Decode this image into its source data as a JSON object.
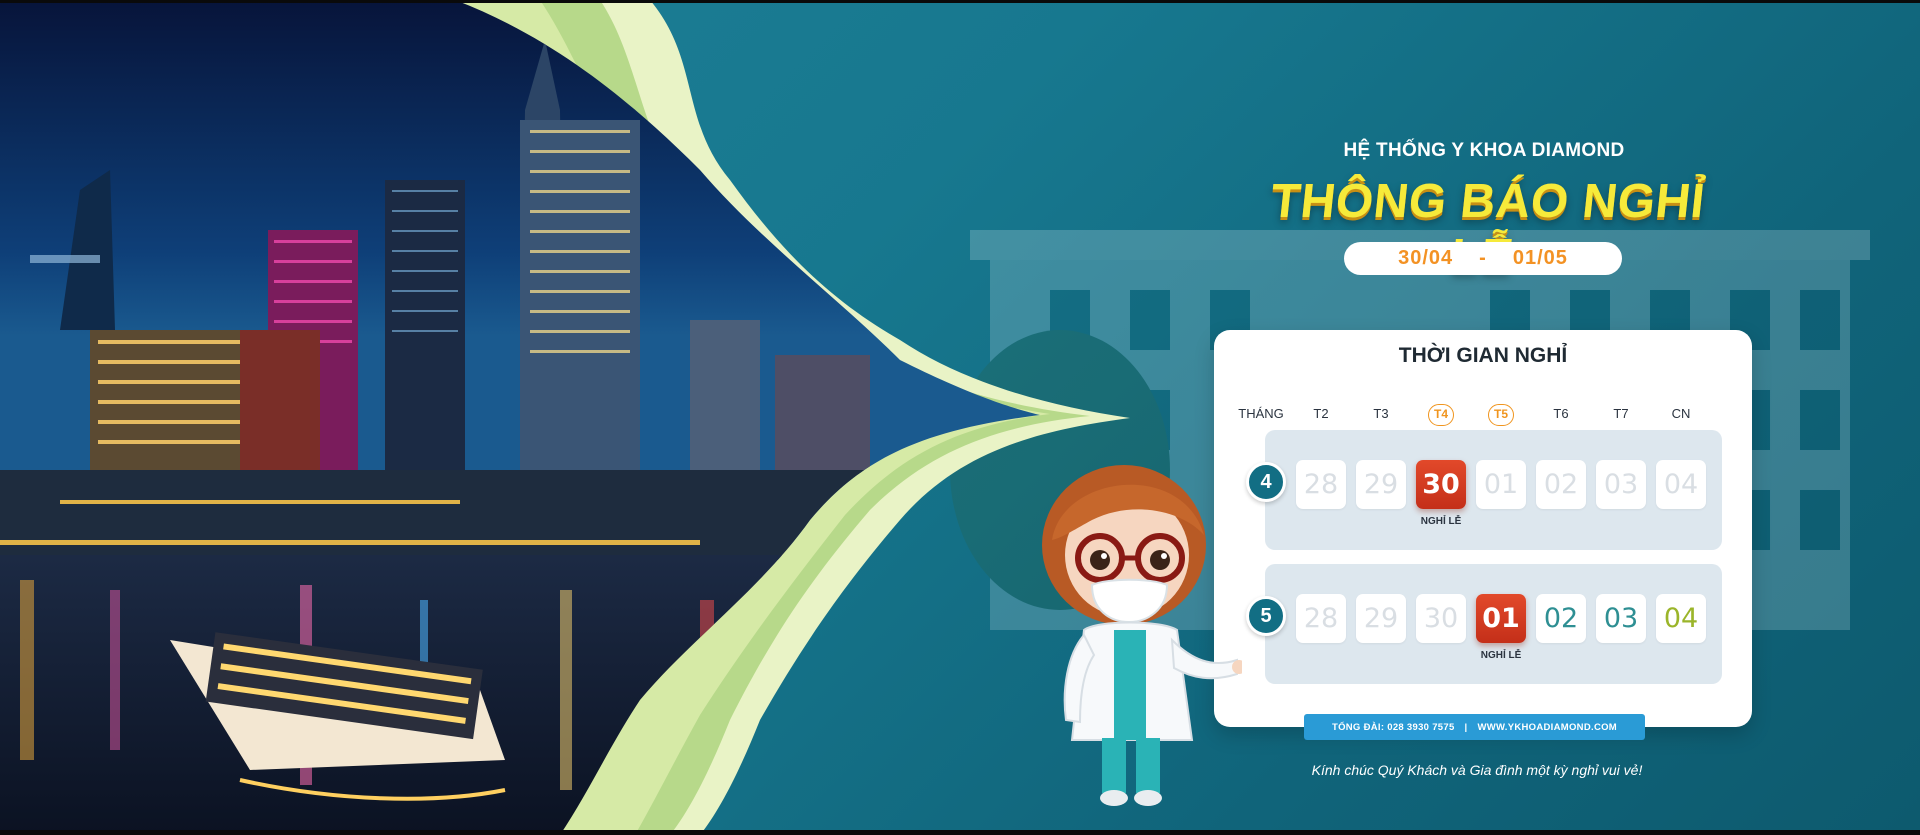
{
  "header": {
    "brand": "HỆ THỐNG Y KHOA DIAMOND",
    "title": "THÔNG BÁO NGHỈ LỄ",
    "date_from": "30/04",
    "date_sep": "-",
    "date_to": "01/05"
  },
  "calendar": {
    "title": "THỜI GIAN NGHỈ",
    "month_header": "THÁNG",
    "weekdays": [
      "T2",
      "T3",
      "T4",
      "T5",
      "T6",
      "T7",
      "CN"
    ],
    "highlighted_weekdays": [
      "T4",
      "T5"
    ],
    "months": [
      {
        "month": "4",
        "days": [
          "28",
          "29",
          "30",
          "01",
          "02",
          "03",
          "04"
        ],
        "holiday_day": "30",
        "holiday_label": "NGHỈ LỄ"
      },
      {
        "month": "5",
        "days": [
          "28",
          "29",
          "30",
          "01",
          "02",
          "03",
          "04"
        ],
        "holiday_day": "01",
        "holiday_label": "NGHỈ LỄ"
      }
    ]
  },
  "contact": {
    "hotline": "TỔNG ĐÀI: 028 3930 7575",
    "separator": "|",
    "website": "WWW.YKHOADIAMOND.COM"
  },
  "greeting": "Kính chúc Quý Khách và Gia đình một kỳ nghỉ vui vẻ!",
  "colors": {
    "background_teal": "#17788f",
    "title_yellow": "#f6ea3a",
    "date_orange": "#f39224",
    "holiday_red": "#d23c20",
    "contact_blue": "#2a9bd6",
    "month_badge": "#126e84"
  },
  "icons": [
    "city-night-photo",
    "doctor-mascot"
  ]
}
